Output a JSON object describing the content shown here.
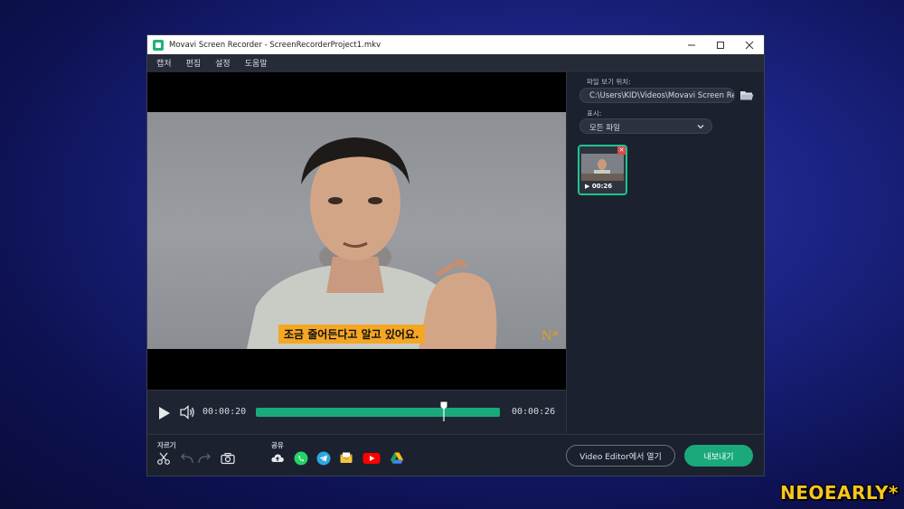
{
  "window": {
    "title": "Movavi Screen Recorder - ScreenRecorderProject1.mkv",
    "minimize_icon": "minimize-icon",
    "maximize_icon": "maximize-icon",
    "close_icon": "close-icon"
  },
  "menu": {
    "items": [
      "캡처",
      "편집",
      "설정",
      "도움말"
    ]
  },
  "video": {
    "subtitle": "조금 줄어든다고 알고 있어요.",
    "corner_mark": "N*"
  },
  "player": {
    "current_time": "00:00:20",
    "total_time": "00:00:26",
    "progress": 0.77
  },
  "panel": {
    "location_label": "파일 보기 위치:",
    "location_value": "C:\\Users\\KID\\Videos\\Movavi Screen Recorder",
    "filter_label": "표시:",
    "filter_value": "모든 파일",
    "thumbnail_duration": "00:26"
  },
  "bottom": {
    "cut_label": "자르기",
    "share_label": "공유",
    "open_editor_label": "Video Editor에서 열기",
    "export_label": "내보내기"
  },
  "colors": {
    "accent": "#1aa97a",
    "window_bg": "#1f2432",
    "subtitle_bg": "#f5a623"
  },
  "watermark": "NEOEARLY*"
}
